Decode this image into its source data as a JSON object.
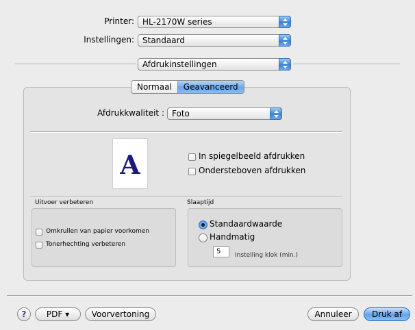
{
  "top": {
    "printer_label": "Printer:",
    "printer_value": "HL-2170W series",
    "settings_label": "Instellingen:",
    "settings_value": "Standaard",
    "section_value": "Afdrukinstellingen"
  },
  "tabs": {
    "normal": "Normaal",
    "advanced": "Geavanceerd",
    "selected": "Geavanceerd"
  },
  "quality": {
    "label": "Afdrukkwaliteit :",
    "value": "Foto"
  },
  "preview": {
    "glyph": "A"
  },
  "options": {
    "mirror": {
      "label": "In spiegelbeeld afdrukken",
      "checked": false
    },
    "upside_down": {
      "label": "Ondersteboven afdrukken",
      "checked": false
    }
  },
  "improve": {
    "title": "Uitvoer verbeteren",
    "curl": {
      "label": "Omkrullen van papier voorkomen",
      "checked": false
    },
    "toner": {
      "label": "Tonerhechting verbeteren",
      "checked": false
    }
  },
  "sleep": {
    "title": "Slaaptijd",
    "default": {
      "label": "Standaardwaarde",
      "selected": true
    },
    "manual": {
      "label": "Handmatig",
      "selected": false
    },
    "minutes_value": "5",
    "minutes_label": "Instelling klok (min.)"
  },
  "footer": {
    "help": "?",
    "pdf": "PDF ▾",
    "preview": "Voorvertoning",
    "cancel": "Annuleer",
    "print": "Druk af"
  },
  "colors": {
    "accent": "#5ea2ec",
    "preview_letter": "#1a1a80"
  }
}
